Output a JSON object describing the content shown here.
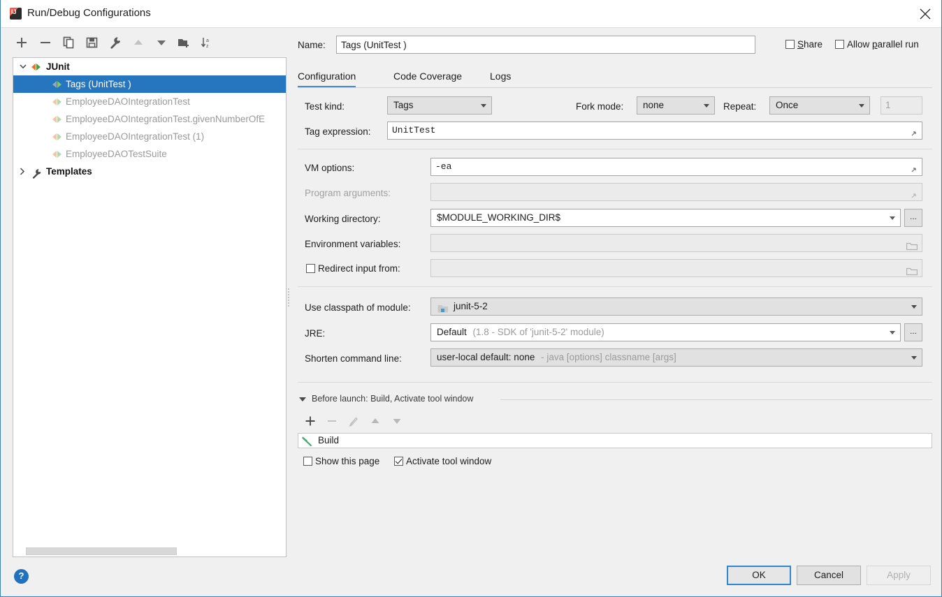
{
  "window": {
    "title": "Run/Debug Configurations",
    "app_icon": "intellij-idea-icon",
    "close_icon": "close-icon"
  },
  "toolbar": {
    "buttons": [
      {
        "name": "add-configuration-button",
        "icon": "plus-icon",
        "tooltip": "Add New Configuration"
      },
      {
        "name": "remove-configuration-button",
        "icon": "minus-icon",
        "tooltip": "Remove Configuration"
      },
      {
        "name": "copy-configuration-button",
        "icon": "copy-icon",
        "tooltip": "Copy Configuration"
      },
      {
        "name": "save-configuration-button",
        "icon": "save-icon",
        "tooltip": "Save Configuration"
      },
      {
        "name": "edit-templates-button",
        "icon": "wrench-icon",
        "tooltip": "Edit Templates"
      },
      {
        "name": "move-up-button",
        "icon": "arrow-up-icon",
        "tooltip": "Move Up"
      },
      {
        "name": "move-down-button",
        "icon": "arrow-down-icon",
        "tooltip": "Move Down"
      },
      {
        "name": "create-folder-button",
        "icon": "folder-add-icon",
        "tooltip": "Create New Folder"
      },
      {
        "name": "sort-configurations-button",
        "icon": "sort-az-icon",
        "tooltip": "Sort Configurations"
      }
    ]
  },
  "tree": {
    "groups": [
      {
        "label": "JUnit",
        "icon": "junit-icon",
        "expanded": true,
        "children": [
          {
            "label": "Tags (UnitTest )",
            "icon": "junit-icon",
            "selected": true
          },
          {
            "label": "EmployeeDAOIntegrationTest",
            "icon": "junit-icon",
            "selected": false
          },
          {
            "label": "EmployeeDAOIntegrationTest.givenNumberOfE",
            "icon": "junit-icon",
            "selected": false
          },
          {
            "label": "EmployeeDAOIntegrationTest (1)",
            "icon": "junit-icon",
            "selected": false
          },
          {
            "label": "EmployeeDAOTestSuite",
            "icon": "junit-icon",
            "selected": false
          }
        ]
      },
      {
        "label": "Templates",
        "icon": "wrench-icon",
        "expanded": false,
        "children": []
      }
    ]
  },
  "header": {
    "name_label": "Name:",
    "name_value": "Tags (UnitTest )",
    "share_label": "Share",
    "share_checked": false,
    "parallel_label": "Allow parallel run",
    "parallel_checked": false
  },
  "tabs": [
    {
      "label": "Configuration",
      "active": true
    },
    {
      "label": "Code Coverage",
      "active": false
    },
    {
      "label": "Logs",
      "active": false
    }
  ],
  "form": {
    "test_kind_label": "Test kind:",
    "test_kind_value": "Tags",
    "fork_mode_label": "Fork mode:",
    "fork_mode_value": "none",
    "repeat_label": "Repeat:",
    "repeat_value": "Once",
    "repeat_count": "1",
    "tag_expression_label": "Tag expression:",
    "tag_expression_value": "UnitTest",
    "vm_options_label": "VM options:",
    "vm_options_value": "-ea",
    "program_arguments_label": "Program arguments:",
    "program_arguments_value": "",
    "working_directory_label": "Working directory:",
    "working_directory_value": "$MODULE_WORKING_DIR$",
    "environment_variables_label": "Environment variables:",
    "environment_variables_value": "",
    "redirect_input_label": "Redirect input from:",
    "redirect_input_checked": false,
    "redirect_input_value": "",
    "classpath_module_label": "Use classpath of module:",
    "classpath_module_value": "junit-5-2",
    "jre_label": "JRE:",
    "jre_value": "Default",
    "jre_hint": "(1.8 - SDK of 'junit-5-2' module)",
    "shorten_command_label": "Shorten command line:",
    "shorten_command_value": "user-local default: none",
    "shorten_command_hint": "- java [options] classname [args]",
    "browse_button_label": "..."
  },
  "before_launch": {
    "title": "Before launch: Build, Activate tool window",
    "buttons": [
      {
        "name": "add-task-button",
        "icon": "plus-icon"
      },
      {
        "name": "remove-task-button",
        "icon": "minus-icon"
      },
      {
        "name": "edit-task-button",
        "icon": "pencil-icon"
      },
      {
        "name": "move-task-up-button",
        "icon": "arrow-up-icon"
      },
      {
        "name": "move-task-down-button",
        "icon": "arrow-down-icon"
      }
    ],
    "tasks": [
      {
        "label": "Build",
        "icon": "hammer-icon"
      }
    ],
    "show_page_label": "Show this page",
    "show_page_checked": false,
    "activate_tool_window_label": "Activate tool window",
    "activate_tool_window_checked": true
  },
  "footer": {
    "help_label": "?",
    "ok_label": "OK",
    "cancel_label": "Cancel",
    "apply_label": "Apply",
    "apply_enabled": false
  },
  "colors": {
    "selection_blue": "#2675bf",
    "accent_blue": "#4a88c7",
    "ok_border": "#2f86d1",
    "help_blue": "#1f72bf",
    "window_border": "#3f7fb8",
    "panel_bg": "#f0f0f0",
    "junit_orange": "#e8732c",
    "junit_green": "#4a9b4a",
    "hammer_green": "#4fa86a"
  }
}
